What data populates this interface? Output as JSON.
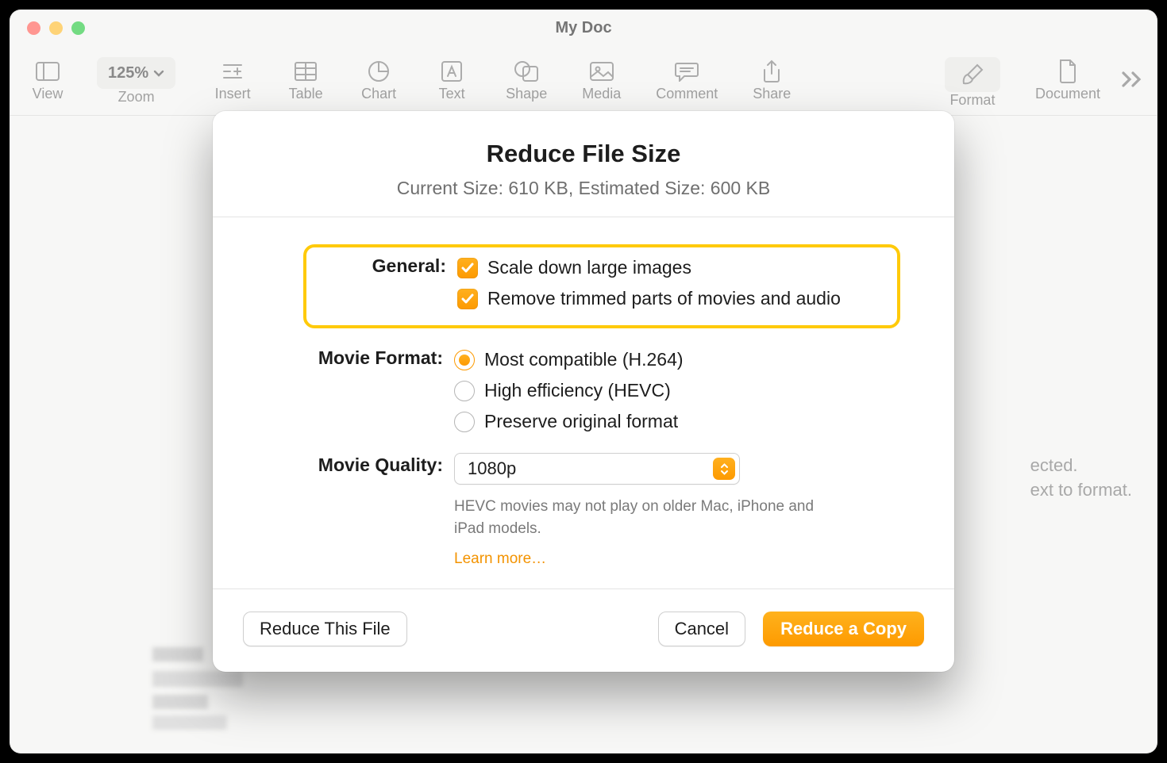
{
  "window": {
    "title": "My Doc",
    "toolbar": {
      "view": "View",
      "zoom_value": "125%",
      "zoom_label": "Zoom",
      "insert": "Insert",
      "table": "Table",
      "chart": "Chart",
      "text": "Text",
      "shape": "Shape",
      "media": "Media",
      "comment": "Comment",
      "share": "Share",
      "format": "Format",
      "document": "Document"
    },
    "panel_hint_line1": "ected.",
    "panel_hint_line2": "ext to format."
  },
  "dialog": {
    "title": "Reduce File Size",
    "subtitle": "Current Size: 610 KB, Estimated Size: 600 KB",
    "general_label": "General:",
    "general": {
      "scale_down": "Scale down large images",
      "remove_trimmed": "Remove trimmed parts of movies and audio"
    },
    "movie_format_label": "Movie Format:",
    "movie_format": {
      "most_compatible": "Most compatible (H.264)",
      "high_efficiency": "High efficiency (HEVC)",
      "preserve": "Preserve original format"
    },
    "movie_quality_label": "Movie Quality:",
    "movie_quality_value": "1080p",
    "helper": "HEVC movies may not play on older Mac, iPhone and iPad models.",
    "learn_more": "Learn more…",
    "buttons": {
      "reduce_this": "Reduce This File",
      "cancel": "Cancel",
      "reduce_copy": "Reduce a Copy"
    }
  }
}
